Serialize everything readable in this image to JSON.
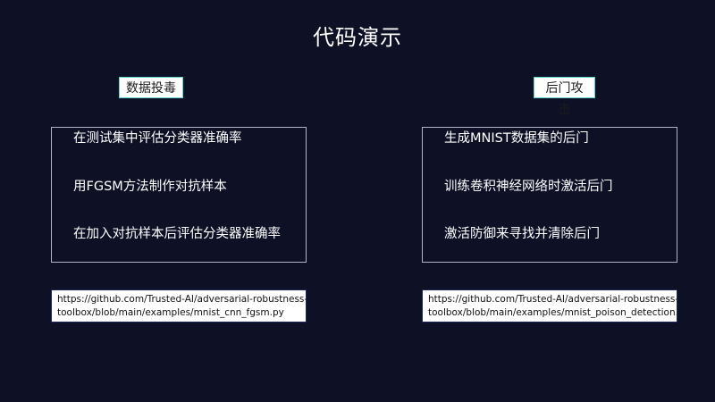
{
  "slide": {
    "title": "代码演示",
    "left": {
      "tag": "数据投毒",
      "items": [
        "在测试集中评估分类器准确率",
        "用FGSM方法制作对抗样本",
        "在加入对抗样本后评估分类器准确率"
      ],
      "link": {
        "line1": "https://github.com/Trusted-AI/adversarial-robustness-",
        "line2": "toolbox/blob/main/examples/mnist_cnn_fgsm.py"
      }
    },
    "right": {
      "tag": "后门攻击",
      "items": [
        "生成MNIST数据集的后门",
        "训练卷积神经网络时激活后门",
        "激活防御来寻找并清除后门"
      ],
      "link": {
        "line1": "https://github.com/Trusted-AI/adversarial-robustness-",
        "line2": "toolbox/blob/main/examples/mnist_poison_detection.py"
      }
    }
  },
  "colors": {
    "background": "#0e1126",
    "tag_border": "#5fd3d6",
    "panel_border": "#aeb6c8"
  }
}
